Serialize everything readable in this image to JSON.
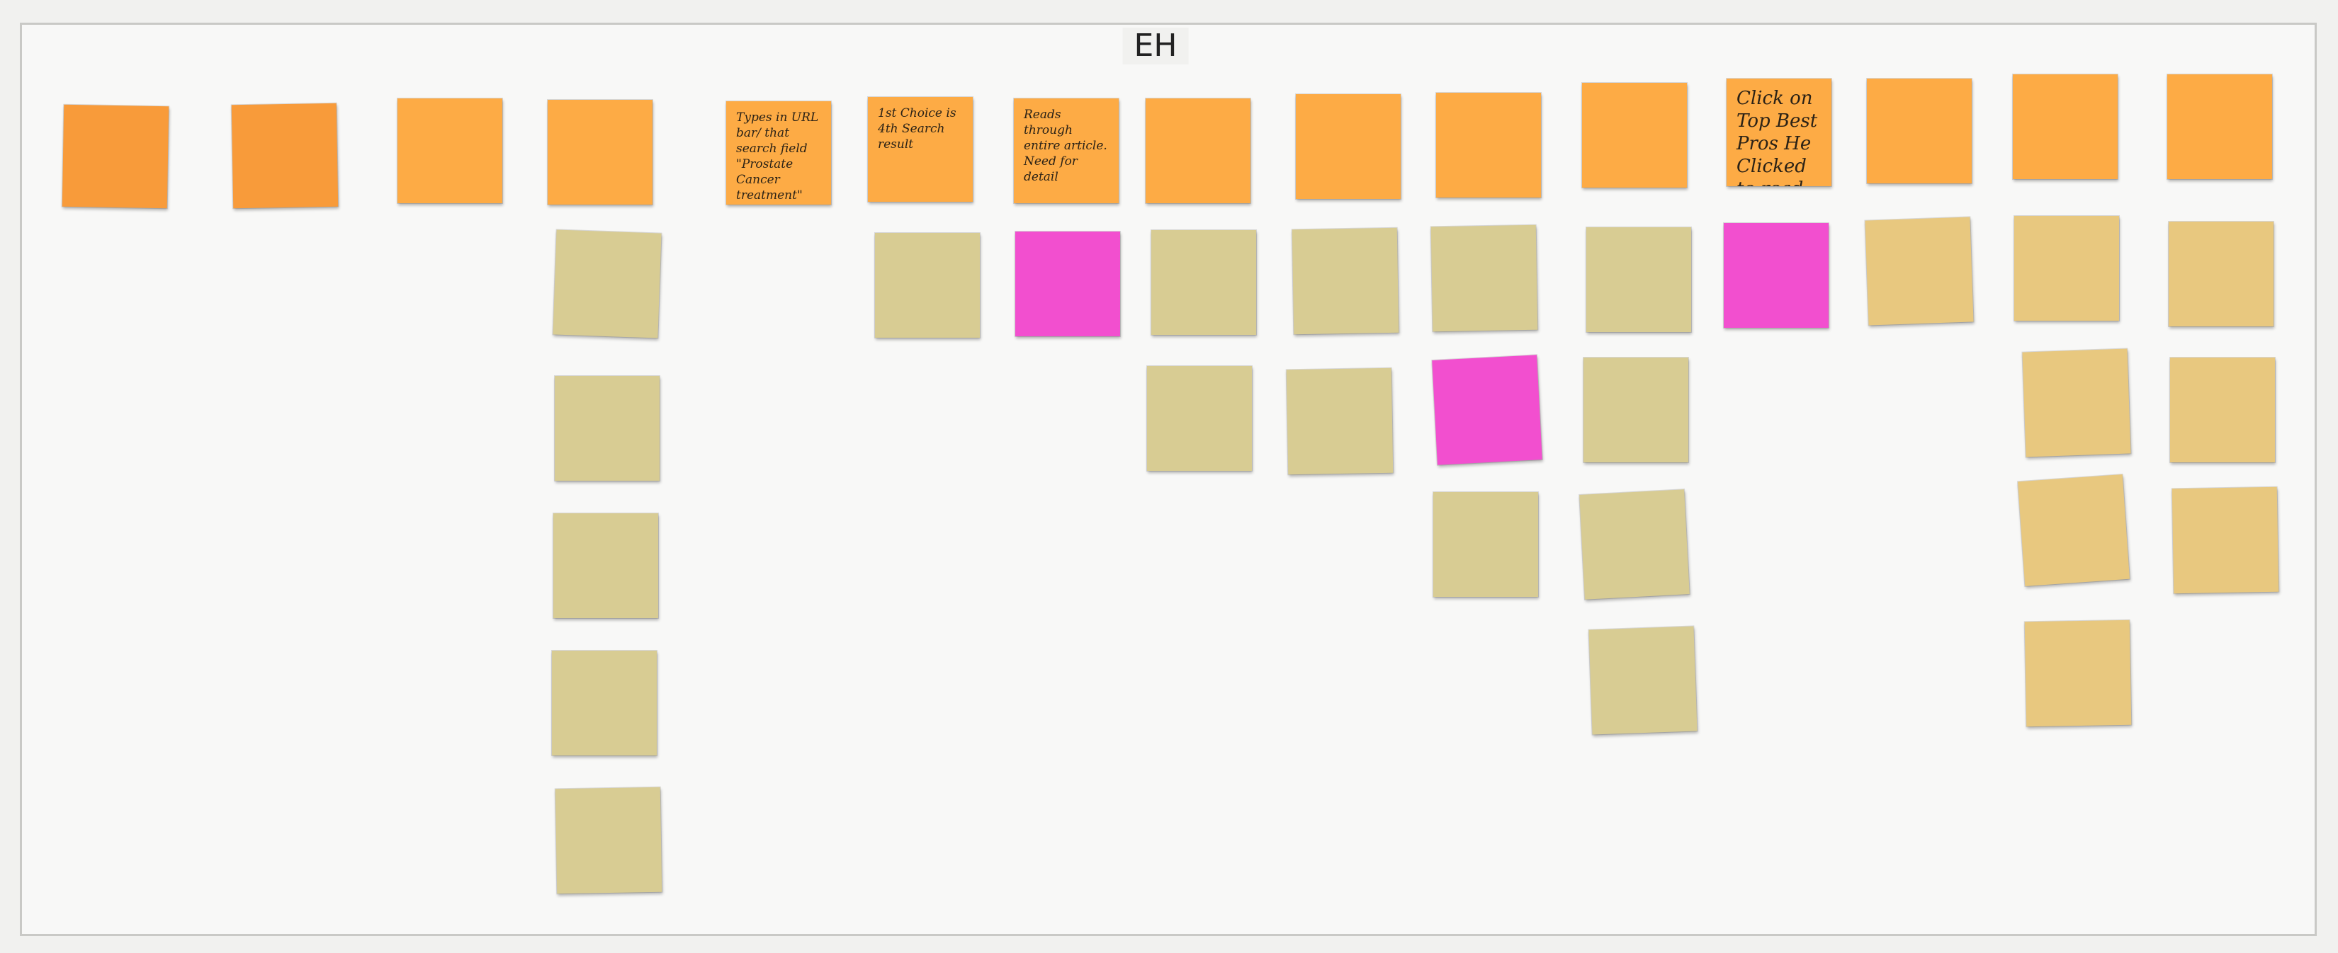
{
  "board": {
    "title": "EH"
  },
  "colors": {
    "orange": "#fdab45",
    "tan": "#d8cc93",
    "tan_gold": "#e8c87f",
    "pink": "#f24fcf",
    "canvas": "#f8f8f7"
  },
  "notes": {
    "n01": {
      "text": ""
    },
    "n02": {
      "text": ""
    },
    "n03": {
      "text": ""
    },
    "n04": {
      "text": ""
    },
    "n05": {
      "text": "Types in URL bar/ that search field \"Prostate Cancer treatment\""
    },
    "n06": {
      "text": "1st Choice is 4th Search result"
    },
    "n07": {
      "text": "Reads through entire article. Need for detail"
    },
    "n08": {
      "text": ""
    },
    "n09": {
      "text": ""
    },
    "n10": {
      "text": ""
    },
    "n11": {
      "text": ""
    },
    "n12": {
      "text": "Click on Top Best Pros He Clicked to read through"
    },
    "n13": {
      "text": ""
    },
    "n14": {
      "text": ""
    },
    "n15": {
      "text": ""
    },
    "n16": {
      "text": ""
    },
    "n17": {
      "text": ""
    },
    "n18": {
      "text": ""
    },
    "n19": {
      "text": ""
    },
    "n20": {
      "text": ""
    },
    "n21": {
      "text": ""
    },
    "n22": {
      "text": ""
    },
    "n23": {
      "text": ""
    },
    "n24": {
      "text": ""
    },
    "n25": {
      "text": ""
    },
    "n26": {
      "text": ""
    },
    "n27": {
      "text": ""
    },
    "n28": {
      "text": ""
    },
    "n29": {
      "text": ""
    },
    "n30": {
      "text": ""
    },
    "n31": {
      "text": ""
    },
    "n32": {
      "text": ""
    },
    "n33": {
      "text": ""
    },
    "n34": {
      "text": ""
    },
    "n35": {
      "text": ""
    },
    "n36": {
      "text": ""
    },
    "n37": {
      "text": ""
    },
    "n38": {
      "text": ""
    },
    "n39": {
      "text": ""
    },
    "n40": {
      "text": ""
    },
    "n41": {
      "text": ""
    },
    "n42": {
      "text": ""
    },
    "n43": {
      "text": ""
    },
    "n44": {
      "text": ""
    },
    "n45": {
      "text": ""
    },
    "n46": {
      "text": ""
    },
    "n47": {
      "text": ""
    }
  }
}
